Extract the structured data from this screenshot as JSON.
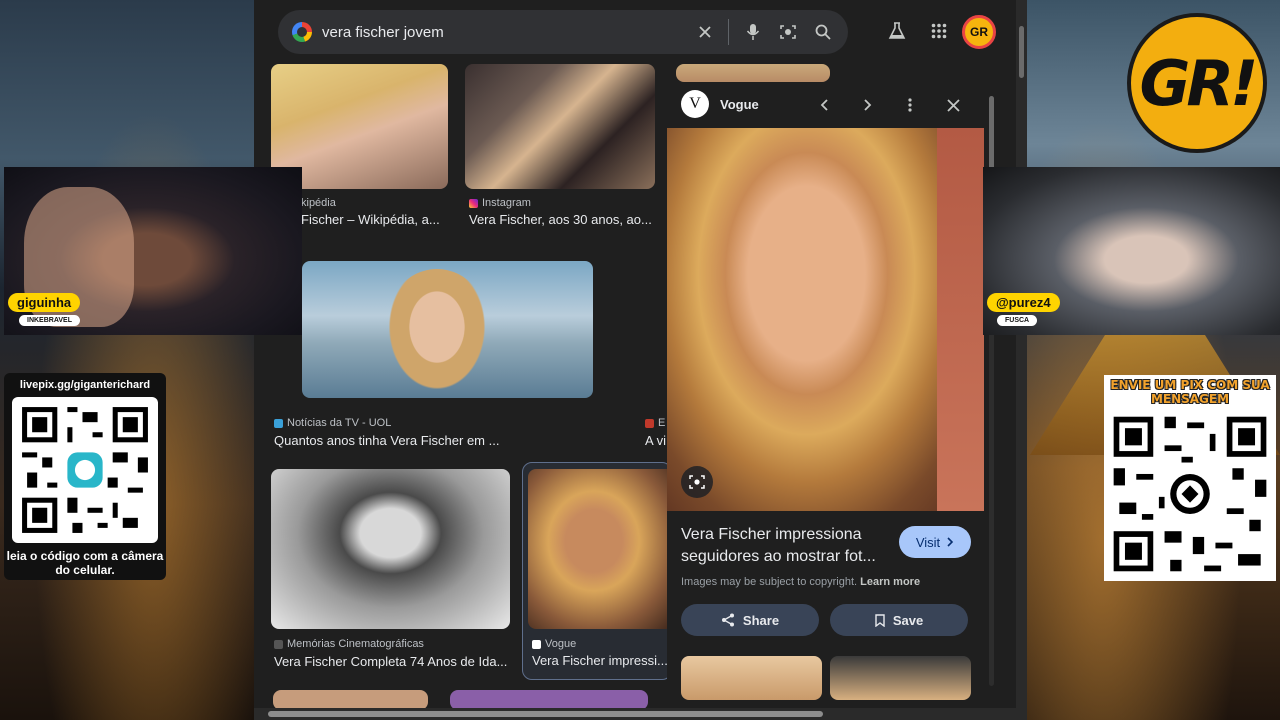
{
  "search": {
    "query": "vera fischer jovem"
  },
  "results": [
    {
      "source": "kipédia",
      "title": "Fischer – Wikipédia, a..."
    },
    {
      "source": "Instagram",
      "title": "Vera Fischer, aos 30 anos, ao..."
    },
    {
      "source": "Notícias da TV - UOL",
      "title": "Quantos anos tinha Vera Fischer em ..."
    },
    {
      "source": "E",
      "title": "A vi"
    },
    {
      "source": "Memórias Cinematográficas",
      "title": "Vera Fischer Completa 74 Anos de Ida..."
    },
    {
      "source": "Vogue",
      "title": "Vera Fischer impressi..."
    }
  ],
  "panel": {
    "site": "Vogue",
    "site_logo": "V",
    "title": "Vera Fischer impressiona seguidores ao mostrar fot...",
    "visit_label": "Visit",
    "copyright": "Images may be subject to copyright.",
    "learn_more": "Learn more",
    "share_label": "Share",
    "save_label": "Save"
  },
  "overlay": {
    "brand_logo": "GR!",
    "avatar_text": "GR",
    "left_streamer": {
      "name": "giguinha",
      "sub": "INKEBRAVEL"
    },
    "right_streamer": {
      "name": "@purez4",
      "sub": "FUSCA"
    },
    "left_qr": {
      "url": "livepix.gg/giganterichard",
      "caption": "leia o código com a câmera do celular."
    },
    "right_qr": {
      "header": "ENVIE UM PIX COM SUA MENSAGEM"
    }
  },
  "colors": {
    "page_bg": "#1f1f1f",
    "search_bg": "#303134",
    "visit_bg": "#a8c7fa",
    "action_bg": "#394457",
    "tag_yellow": "#ffd400"
  },
  "icons": [
    "google-logo-icon",
    "clear-icon",
    "mic-icon",
    "lens-icon",
    "search-icon",
    "labs-flask-icon",
    "apps-grid-icon",
    "chevron-left-icon",
    "chevron-right-icon",
    "more-vert-icon",
    "close-icon",
    "share-icon",
    "bookmark-icon",
    "chevron-right-small-icon"
  ]
}
